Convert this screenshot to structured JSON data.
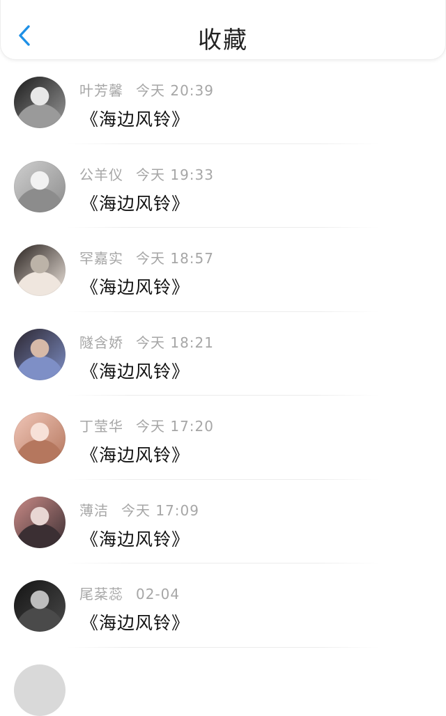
{
  "header": {
    "title": "收藏"
  },
  "list": [
    {
      "name": "叶芳馨",
      "time": "今天 20:39",
      "song": "《海边风铃》",
      "avatar_colors": [
        "#1b1b1b",
        "#9a9a9a",
        "#e8e8e8"
      ]
    },
    {
      "name": "公羊仪",
      "time": "今天 19:33",
      "song": "《海边风铃》",
      "avatar_colors": [
        "#cfcfcf",
        "#8c8c8c",
        "#f2f2f2"
      ]
    },
    {
      "name": "罕嘉实",
      "time": "今天 18:57",
      "song": "《海边风铃》",
      "avatar_colors": [
        "#2a2320",
        "#efe6de",
        "#bcb3a8"
      ]
    },
    {
      "name": "隧含娇",
      "time": "今天 18:21",
      "song": "《海边风铃》",
      "avatar_colors": [
        "#2c2630",
        "#7e8fc6",
        "#d6b9a8"
      ]
    },
    {
      "name": "丁莹华",
      "time": "今天 17:20",
      "song": "《海边风铃》",
      "avatar_colors": [
        "#f0c6b8",
        "#b5775e",
        "#f7e1d8"
      ]
    },
    {
      "name": "薄洁",
      "time": "今天 17:09",
      "song": "《海边风铃》",
      "avatar_colors": [
        "#c98a86",
        "#3b2f33",
        "#e8d6d3"
      ]
    },
    {
      "name": "尾棻蕊",
      "time": "02-04",
      "song": "《海边风铃》",
      "avatar_colors": [
        "#141414",
        "#4a4a4a",
        "#bdbdbd"
      ]
    }
  ],
  "colors": {
    "accent": "#1e90e6",
    "meta_text": "#a6a6a6",
    "divider": "#ececec"
  }
}
